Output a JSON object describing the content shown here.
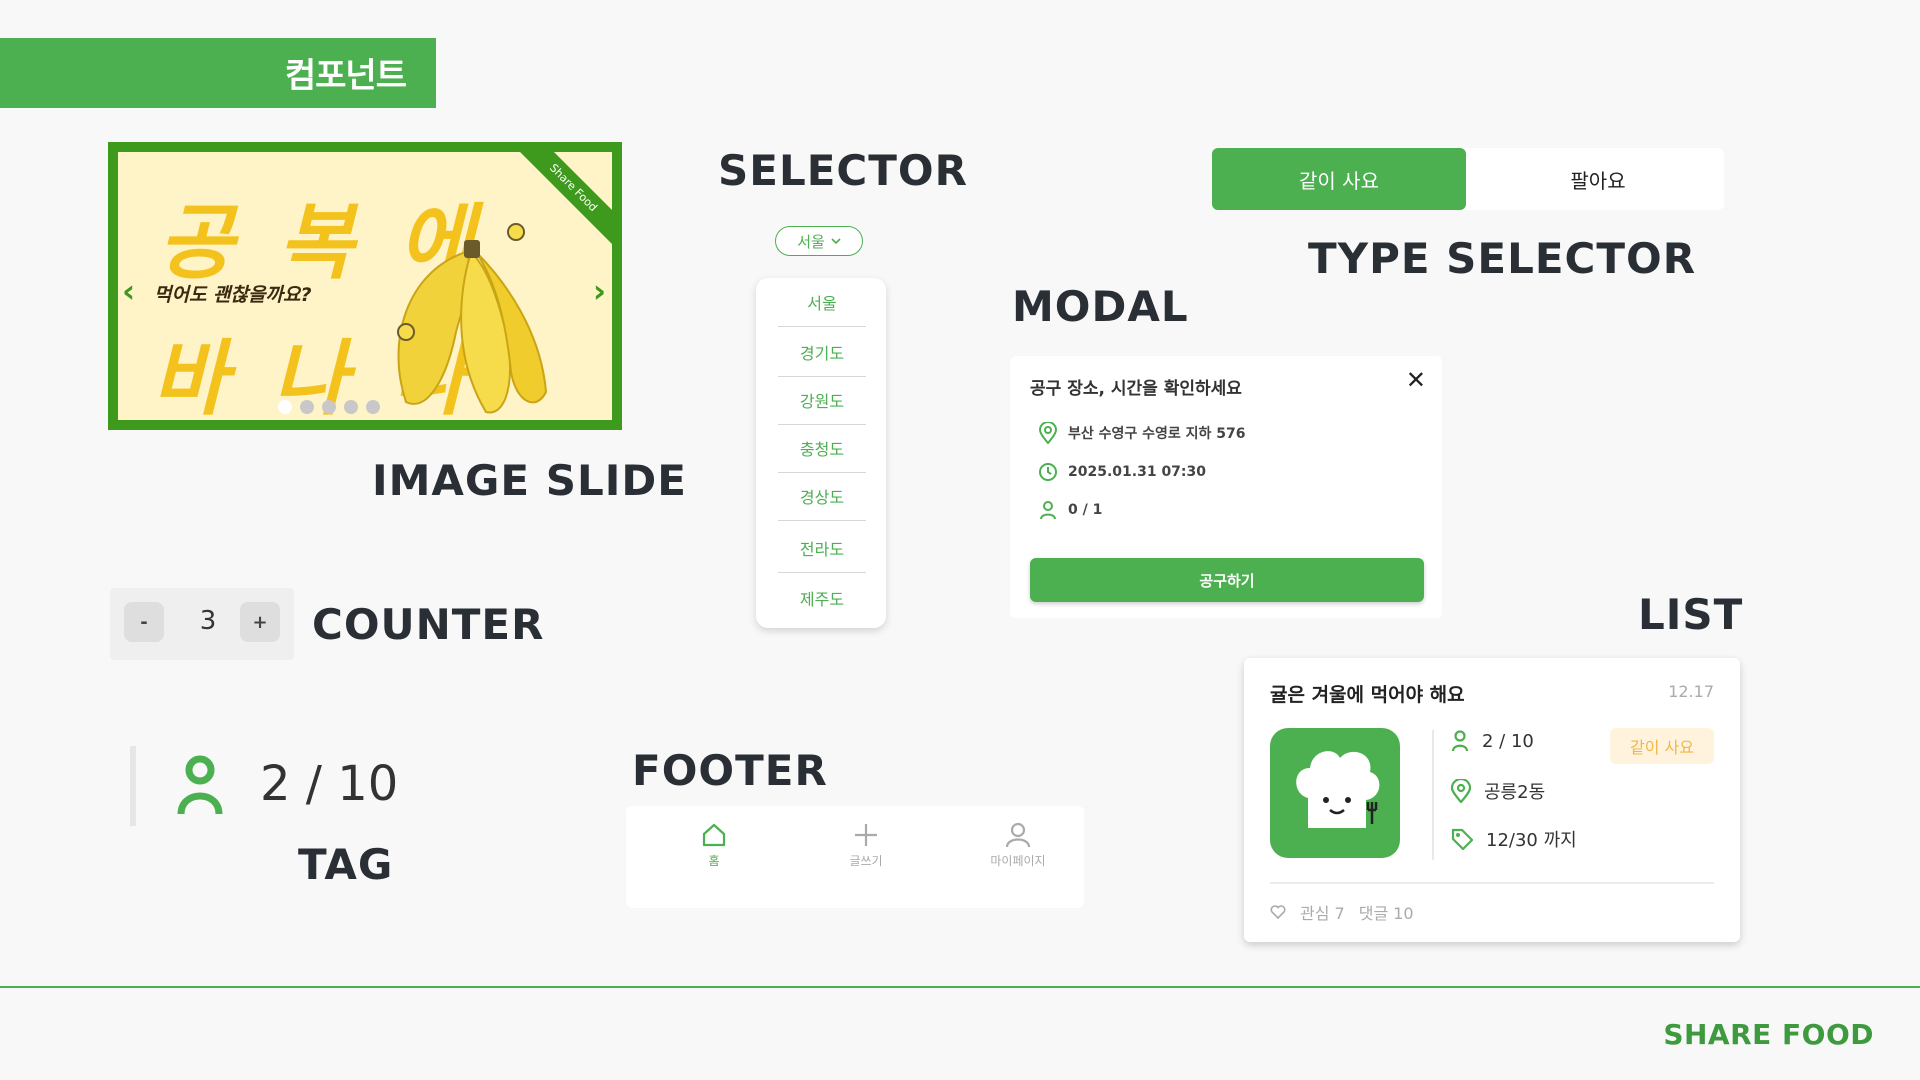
{
  "banner": {
    "title": "컴포넌트"
  },
  "slide": {
    "line1": "공 복 에",
    "line2": "바 나  나",
    "subtitle": "먹어도 괜찮을까요?",
    "ribbon": "Share Food",
    "prev": "‹",
    "next": "›",
    "dots": 5,
    "active_dot": 1,
    "caption": "IMAGE SLIDE"
  },
  "selector": {
    "title": "SELECTOR",
    "selected": "서울",
    "options": [
      "서울",
      "경기도",
      "강원도",
      "충청도",
      "경상도",
      "전라도",
      "제주도"
    ]
  },
  "type_selector": {
    "option_a": "같이 사요",
    "option_b": "팔아요",
    "caption": "TYPE SELECTOR"
  },
  "modal": {
    "caption": "MODAL",
    "heading": "공구 장소, 시간을 확인하세요",
    "close": "✕",
    "location": "부산 수영구 수영로 지하 576",
    "datetime": "2025.01.31 07:30",
    "people": "0 / 1",
    "button": "공구하기"
  },
  "counter": {
    "minus": "-",
    "value": "3",
    "plus": "+",
    "caption": "COUNTER"
  },
  "tag": {
    "value": "2 / 10",
    "caption": "TAG"
  },
  "footer": {
    "caption": "FOOTER",
    "items": [
      {
        "label": "홈",
        "icon": "home-icon"
      },
      {
        "label": "글쓰기",
        "icon": "plus-icon"
      },
      {
        "label": "마이페이지",
        "icon": "user-icon"
      }
    ]
  },
  "list": {
    "caption": "LIST",
    "title": "귤은 겨울에 먹어야 해요",
    "date": "12.17",
    "people": "2 / 10",
    "badge": "같이 사요",
    "place": "공릉2동",
    "deadline": "12/30 까지",
    "likes": "관심 7",
    "comments": "댓글 10"
  },
  "brand": "SHARE FOOD",
  "colors": {
    "accent": "#4caf50",
    "brand_dark": "#3e9a3e",
    "badge_bg": "#fff3de",
    "badge_text": "#f2b646"
  }
}
